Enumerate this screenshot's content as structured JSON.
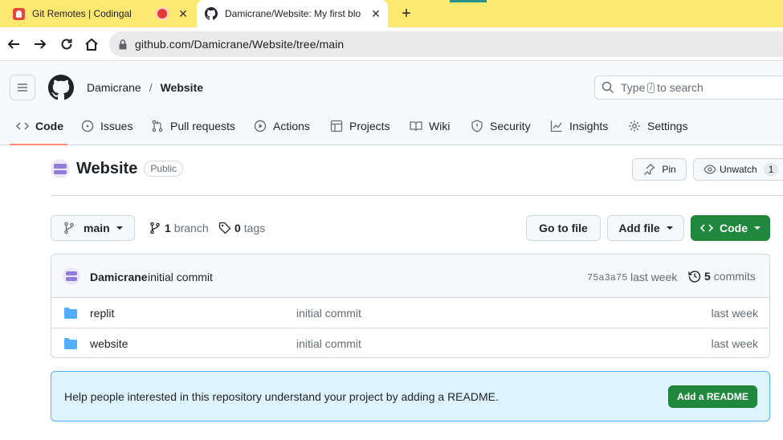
{
  "browser": {
    "tabs": [
      {
        "title": "Git Remotes | Codingal",
        "active": false
      },
      {
        "title": "Damicrane/Website: My first blo",
        "active": true
      }
    ],
    "new_tab_label": "+",
    "close_glyph": "✕",
    "url": "github.com/Damicrane/Website/tree/main",
    "chrome_color": "#fde872"
  },
  "header": {
    "owner": "Damicrane",
    "separator": "/",
    "repo": "Website",
    "search_prefix": "Type",
    "search_key": "/",
    "search_suffix": "to search"
  },
  "repo_nav": [
    {
      "label": "Code",
      "icon": "code-icon",
      "active": true
    },
    {
      "label": "Issues",
      "icon": "issue-icon",
      "active": false
    },
    {
      "label": "Pull requests",
      "icon": "pull-request-icon",
      "active": false
    },
    {
      "label": "Actions",
      "icon": "play-icon",
      "active": false
    },
    {
      "label": "Projects",
      "icon": "table-icon",
      "active": false
    },
    {
      "label": "Wiki",
      "icon": "book-icon",
      "active": false
    },
    {
      "label": "Security",
      "icon": "shield-icon",
      "active": false
    },
    {
      "label": "Insights",
      "icon": "graph-icon",
      "active": false
    },
    {
      "label": "Settings",
      "icon": "gear-icon",
      "active": false
    }
  ],
  "repo_title": {
    "name": "Website",
    "visibility": "Public",
    "pin_label": "Pin",
    "unwatch_label": "Unwatch",
    "watch_count": "1"
  },
  "branch_bar": {
    "branch": "main",
    "branch_count": "1",
    "branch_word": "branch",
    "tag_count": "0",
    "tag_word": "tags",
    "go_to_file": "Go to file",
    "add_file": "Add file",
    "code": "Code"
  },
  "latest_commit": {
    "author": "Damicrane",
    "message": "initial commit",
    "sha": "75a3a75",
    "time": "last week",
    "commit_count": "5",
    "commit_word": "commits"
  },
  "files": [
    {
      "name": "replit",
      "commit": "initial commit",
      "time": "last week",
      "type": "folder"
    },
    {
      "name": "website",
      "commit": "initial commit",
      "time": "last week",
      "type": "folder"
    }
  ],
  "readme_banner": {
    "text": "Help people interested in this repository understand your project by adding a README.",
    "button": "Add a README"
  },
  "colors": {
    "primary_button": "#1f883d",
    "active_tab_underline": "#fd8c73",
    "folder": "#54aeff",
    "banner_bg": "#ddf4ff"
  }
}
